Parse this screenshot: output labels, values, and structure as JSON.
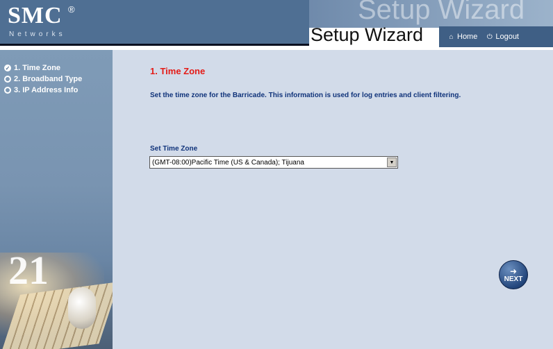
{
  "header": {
    "logo": "SMC",
    "logo_registered": "®",
    "logo_subtitle": "Networks",
    "banner_ghost": "Setup Wizard",
    "title": "Setup Wizard",
    "nav": {
      "home_label": "Home",
      "logout_label": "Logout"
    }
  },
  "sidebar": {
    "steps": [
      {
        "label": "1. Time Zone",
        "checked": true
      },
      {
        "label": "2. Broadband Type",
        "checked": false
      },
      {
        "label": "3. IP Address Info",
        "checked": false
      }
    ],
    "photo_number": "21"
  },
  "main": {
    "title": "1. Time Zone",
    "description": "Set the time zone for the Barricade. This information is used for log entries and client filtering.",
    "timezone": {
      "label": "Set Time Zone",
      "selected": "(GMT-08:00)Pacific Time (US & Canada); Tijuana"
    },
    "next_label": "NEXT"
  },
  "colors": {
    "header_blue": "#4f6f93",
    "nav_blue": "#3f5f85",
    "title_red": "#e41b17",
    "text_blue": "#10337a",
    "content_bg": "#d2dbe9"
  },
  "icons": {
    "home": "home-icon",
    "logout": "logout-icon",
    "next": "next-arrow-icon"
  }
}
